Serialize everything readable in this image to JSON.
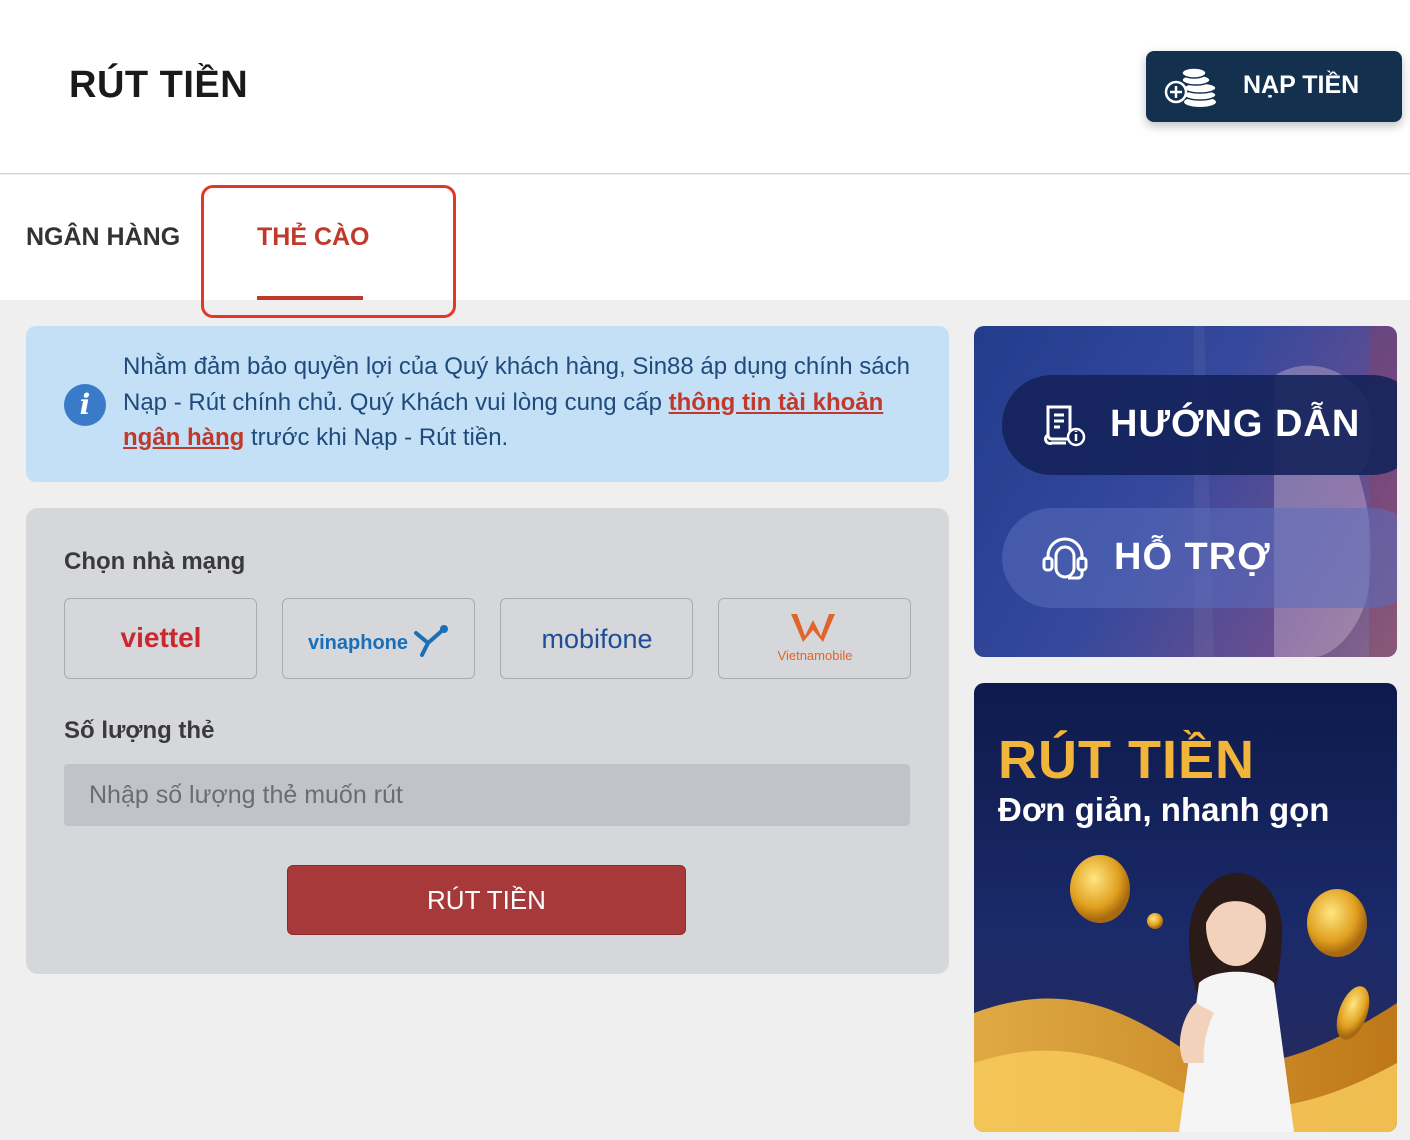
{
  "header": {
    "title": "RÚT TIỀN",
    "deposit_label": "NẠP TIỀN"
  },
  "tabs": [
    {
      "label": "NGÂN HÀNG",
      "active": false
    },
    {
      "label": "THẺ CÀO",
      "active": true
    }
  ],
  "notice": {
    "text_before": "Nhằm đảm bảo quyền lợi của Quý khách hàng, Sin88 áp dụng chính sách Nạp - Rút chính chủ. Quý Khách vui lòng cung cấp ",
    "link_text": "thông tin tài khoản ngân hàng",
    "text_after": " trước khi Nạp - Rút tiền."
  },
  "form": {
    "carrier_label": "Chọn nhà mạng",
    "carriers": [
      {
        "name": "viettel",
        "color": "#c8282e"
      },
      {
        "name": "vinaphone",
        "color": "#1b6fb8"
      },
      {
        "name": "mobifone",
        "color": "#1f4e96"
      },
      {
        "name": "Vietnamobile",
        "color": "#e0652a"
      }
    ],
    "quantity_label": "Số lượng thẻ",
    "quantity_placeholder": "Nhập số lượng thẻ muốn rút",
    "submit_label": "RÚT TIỀN"
  },
  "help": {
    "guide_label": "HƯỚNG DẪN",
    "support_label": "HỖ TRỢ"
  },
  "promo": {
    "title": "RÚT TIỀN",
    "subtitle": "Đơn giản, nhanh gọn"
  },
  "colors": {
    "accent_red": "#c0392b",
    "navy": "#13304f",
    "notice_bg": "#c4e0f6"
  }
}
